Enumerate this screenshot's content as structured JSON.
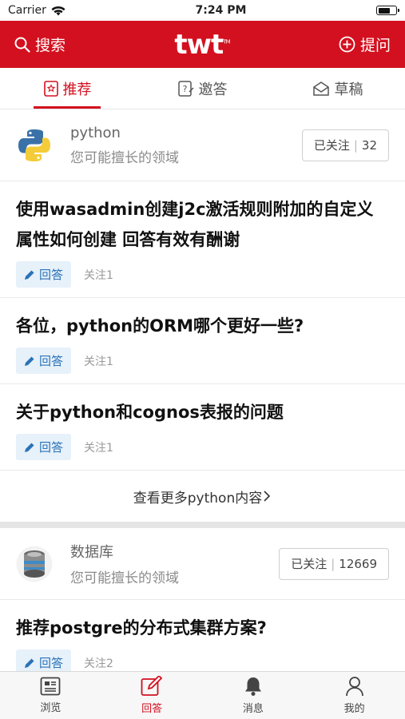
{
  "status_bar": {
    "carrier": "Carrier",
    "time": "7:24 PM"
  },
  "nav": {
    "search_label": "搜索",
    "logo": "twt",
    "ask_label": "提问"
  },
  "tabs": [
    {
      "label": "推荐",
      "active": true
    },
    {
      "label": "邀答",
      "active": false
    },
    {
      "label": "草稿",
      "active": false
    }
  ],
  "sections": [
    {
      "topic": {
        "name": "python",
        "subtitle": "您可能擅长的领域",
        "follow_label": "已关注",
        "follow_count": "32"
      },
      "questions": [
        {
          "title": "使用wasadmin创建j2c激活规则附加的自定义属性如何创建 回答有效有酬谢",
          "answer_label": "回答",
          "follow_text": "关注1"
        },
        {
          "title": "各位，python的ORM哪个更好一些?",
          "answer_label": "回答",
          "follow_text": "关注1"
        },
        {
          "title": "关于python和cognos表报的问题",
          "answer_label": "回答",
          "follow_text": "关注1"
        }
      ],
      "more_label": "查看更多python内容"
    },
    {
      "topic": {
        "name": "数据库",
        "subtitle": "您可能擅长的领域",
        "follow_label": "已关注",
        "follow_count": "12669"
      },
      "questions": [
        {
          "title": "推荐postgre的分布式集群方案?",
          "answer_label": "回答",
          "follow_text": "关注2"
        }
      ]
    }
  ],
  "tabbar": [
    {
      "label": "浏览",
      "icon": "browse-icon",
      "active": false
    },
    {
      "label": "回答",
      "icon": "edit-icon",
      "active": true
    },
    {
      "label": "消息",
      "icon": "bell-icon",
      "active": false
    },
    {
      "label": "我的",
      "icon": "person-icon",
      "active": false
    }
  ],
  "colors": {
    "brand": "#d3101f",
    "answer_bg": "#e6f1fa",
    "answer_text": "#2b72b8"
  }
}
